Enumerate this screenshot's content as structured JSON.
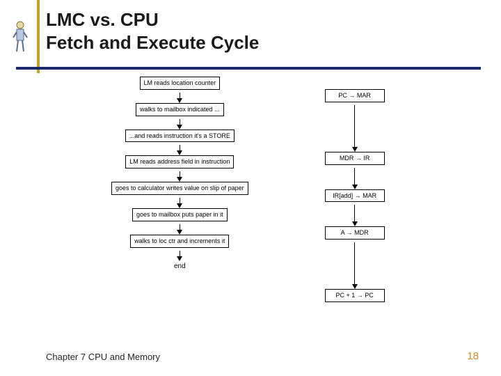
{
  "title": {
    "line1": "LMC vs. CPU",
    "line2": "Fetch and Execute Cycle"
  },
  "diagram": {
    "lmc_steps": [
      "LM reads location counter",
      "walks to mailbox indicated ...",
      "...and reads instruction it's a STORE",
      "LM reads address field in instruction",
      "goes to calculator writes value on slip of paper",
      "goes to mailbox puts paper in it",
      "walks to loc ctr and increments it"
    ],
    "cpu_steps": [
      "PC → MAR",
      "MDR → IR",
      "IR[add] → MAR",
      "A → MDR",
      "PC + 1 → PC"
    ],
    "end_label": "end"
  },
  "footer": {
    "chapter": "Chapter 7 CPU and Memory",
    "page": "18"
  },
  "colors": {
    "accent_gold": "#c9a227",
    "navy": "#1a2a6c",
    "page_num": "#d98b2b"
  }
}
